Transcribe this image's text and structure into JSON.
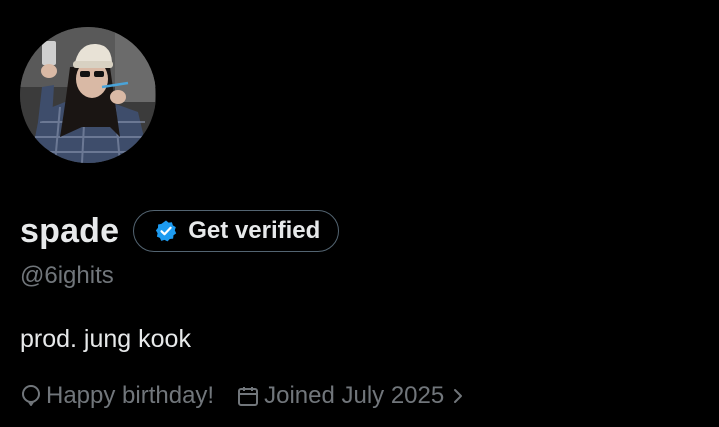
{
  "profile": {
    "display_name": "spade",
    "handle": "@6ighits",
    "bio": "prod. jung kook",
    "verify_button_label": "Get verified",
    "birthday_text": "Happy birthday!",
    "joined_text": "Joined July 2025"
  },
  "icons": {
    "verified_badge": "verified-badge-icon",
    "birthday": "balloon-icon",
    "joined": "calendar-icon",
    "joined_more": "chevron-right-icon"
  },
  "colors": {
    "background": "#000000",
    "text_primary": "#e7e9ea",
    "text_secondary": "#71767b",
    "verified_blue": "#1d9bf0",
    "button_border": "#536471"
  }
}
